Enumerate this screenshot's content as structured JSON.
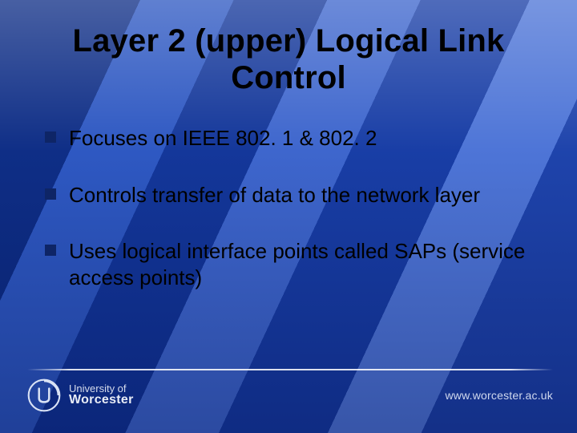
{
  "title": "Layer 2 (upper) Logical Link Control",
  "bullets": [
    "Focuses on IEEE 802. 1 & 802. 2",
    "Controls transfer of data to the network layer",
    "Uses logical interface points called SAPs (service access points)"
  ],
  "footer": {
    "university_line1": "University of",
    "university_line2": "Worcester",
    "url": "www.worcester.ac.uk"
  }
}
